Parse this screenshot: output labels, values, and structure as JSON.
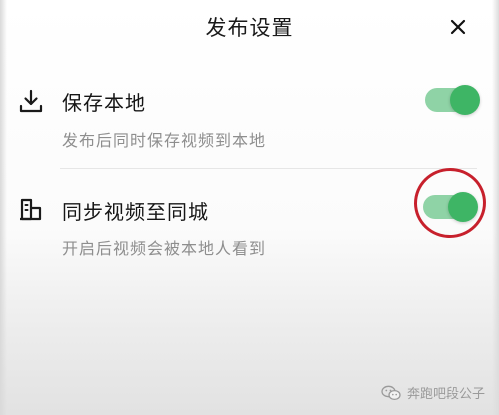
{
  "header": {
    "title": "发布设置",
    "close_icon": "close-icon"
  },
  "settings": [
    {
      "icon": "download-icon",
      "label": "保存本地",
      "description": "发布后同时保存视频到本地",
      "enabled": true
    },
    {
      "icon": "building-icon",
      "label": "同步视频至同城",
      "description": "开启后视频会被本地人看到",
      "enabled": true
    }
  ],
  "watermark": {
    "text": "奔跑吧段公子"
  },
  "colors": {
    "toggle_track": "#8fd3a6",
    "toggle_knob": "#3eb565",
    "annotation_circle": "#c7202c"
  }
}
